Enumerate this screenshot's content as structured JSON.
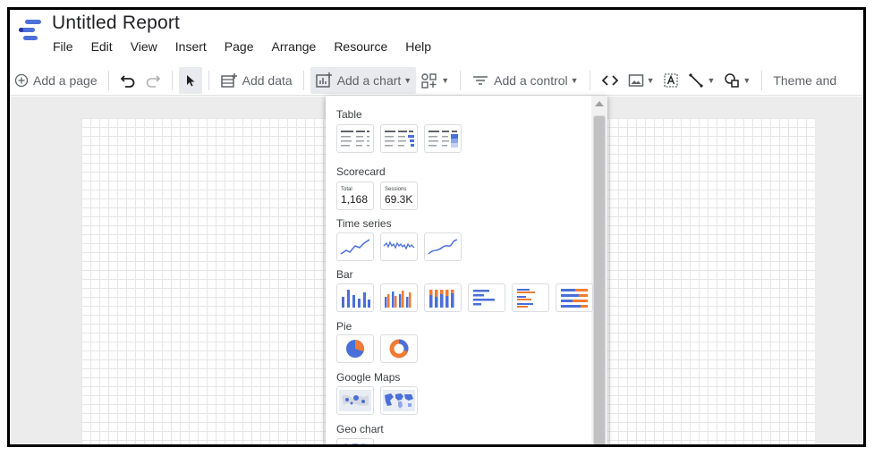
{
  "app": {
    "title": "Untitled Report",
    "menu": [
      "File",
      "Edit",
      "View",
      "Insert",
      "Page",
      "Arrange",
      "Resource",
      "Help"
    ]
  },
  "toolbar": {
    "add_page": "Add a page",
    "add_data": "Add data",
    "add_chart": "Add a chart",
    "add_control": "Add a control",
    "theme": "Theme and"
  },
  "chart_menu": {
    "sections": {
      "table": "Table",
      "scorecard": "Scorecard",
      "time_series": "Time series",
      "bar": "Bar",
      "pie": "Pie",
      "google_maps": "Google Maps",
      "geo_chart": "Geo chart"
    },
    "scorecards": [
      {
        "label": "Total",
        "value": "1,168"
      },
      {
        "label": "Sessions",
        "value": "69.3K"
      }
    ]
  },
  "colors": {
    "blue": "#4a6fd8",
    "orange": "#f07b34",
    "logo_blue": "#4c6fd9",
    "logo_dark": "#27349a"
  }
}
